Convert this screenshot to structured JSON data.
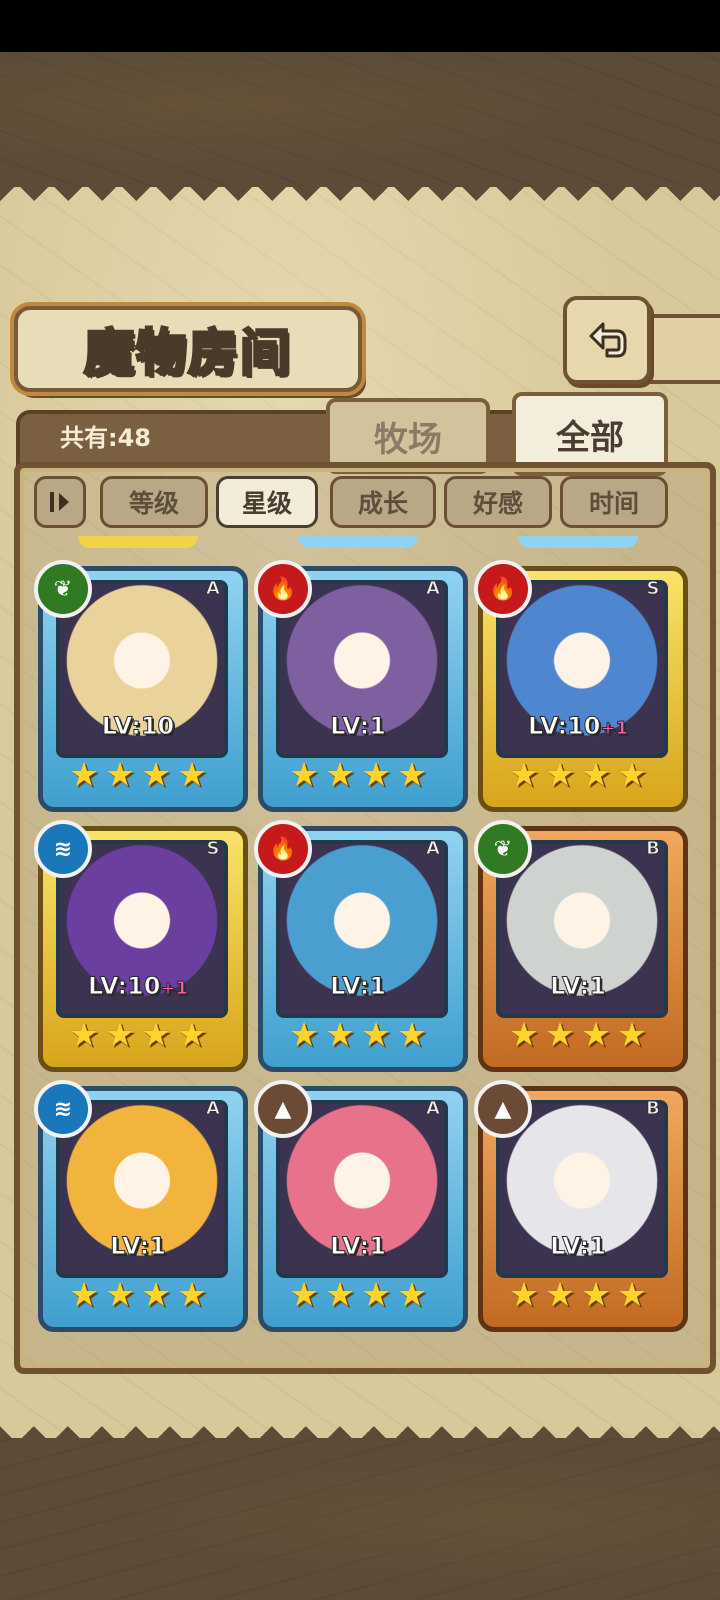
{
  "header": {
    "title": "魔物房间"
  },
  "count": {
    "label": "共有:48"
  },
  "tabs": [
    {
      "label": "牧场",
      "active": false
    },
    {
      "label": "全部",
      "active": true
    }
  ],
  "sort": {
    "toggle_icon": "sort-order-icon",
    "options": [
      {
        "label": "等级",
        "selected": false
      },
      {
        "label": "星级",
        "selected": true
      },
      {
        "label": "成长",
        "selected": false
      },
      {
        "label": "好感",
        "selected": false
      },
      {
        "label": "时间",
        "selected": false
      }
    ]
  },
  "colors": {
    "fire": "#c5191b",
    "leaf": "#2f7a22",
    "water": "#1a77b9",
    "earth": "#6b4a36",
    "frame_blue": "#3f9fcf",
    "frame_gold": "#d8a51a",
    "frame_bronze": "#c26a22",
    "star": "#ffd42a",
    "plus_level": "#ff5fae"
  },
  "monsters": [
    {
      "level": "LV:10",
      "plus": "",
      "rarity": "A",
      "element": "leaf",
      "frame": "blue",
      "stars": 4,
      "tint": "#e9d39a"
    },
    {
      "level": "LV:1",
      "plus": "",
      "rarity": "A",
      "element": "fire",
      "frame": "blue",
      "stars": 4,
      "tint": "#7e5fa0"
    },
    {
      "level": "LV:10",
      "plus": "+1",
      "rarity": "S",
      "element": "fire",
      "frame": "gold",
      "stars": 4,
      "tint": "#4e86cf"
    },
    {
      "level": "LV:10",
      "plus": "+1",
      "rarity": "S",
      "element": "water",
      "frame": "gold",
      "stars": 4,
      "tint": "#6a3fa0"
    },
    {
      "level": "LV:1",
      "plus": "",
      "rarity": "A",
      "element": "fire",
      "frame": "blue",
      "stars": 4,
      "tint": "#4b9fd0"
    },
    {
      "level": "LV:1",
      "plus": "",
      "rarity": "B",
      "element": "leaf",
      "frame": "bronze",
      "stars": 4,
      "tint": "#cfd3cf"
    },
    {
      "level": "LV:1",
      "plus": "",
      "rarity": "A",
      "element": "water",
      "frame": "blue",
      "stars": 4,
      "tint": "#f2b43c"
    },
    {
      "level": "LV:1",
      "plus": "",
      "rarity": "A",
      "element": "earth",
      "frame": "blue",
      "stars": 4,
      "tint": "#e8728a"
    },
    {
      "level": "LV:1",
      "plus": "",
      "rarity": "B",
      "element": "earth",
      "frame": "bronze",
      "stars": 4,
      "tint": "#e6e6ea"
    }
  ]
}
